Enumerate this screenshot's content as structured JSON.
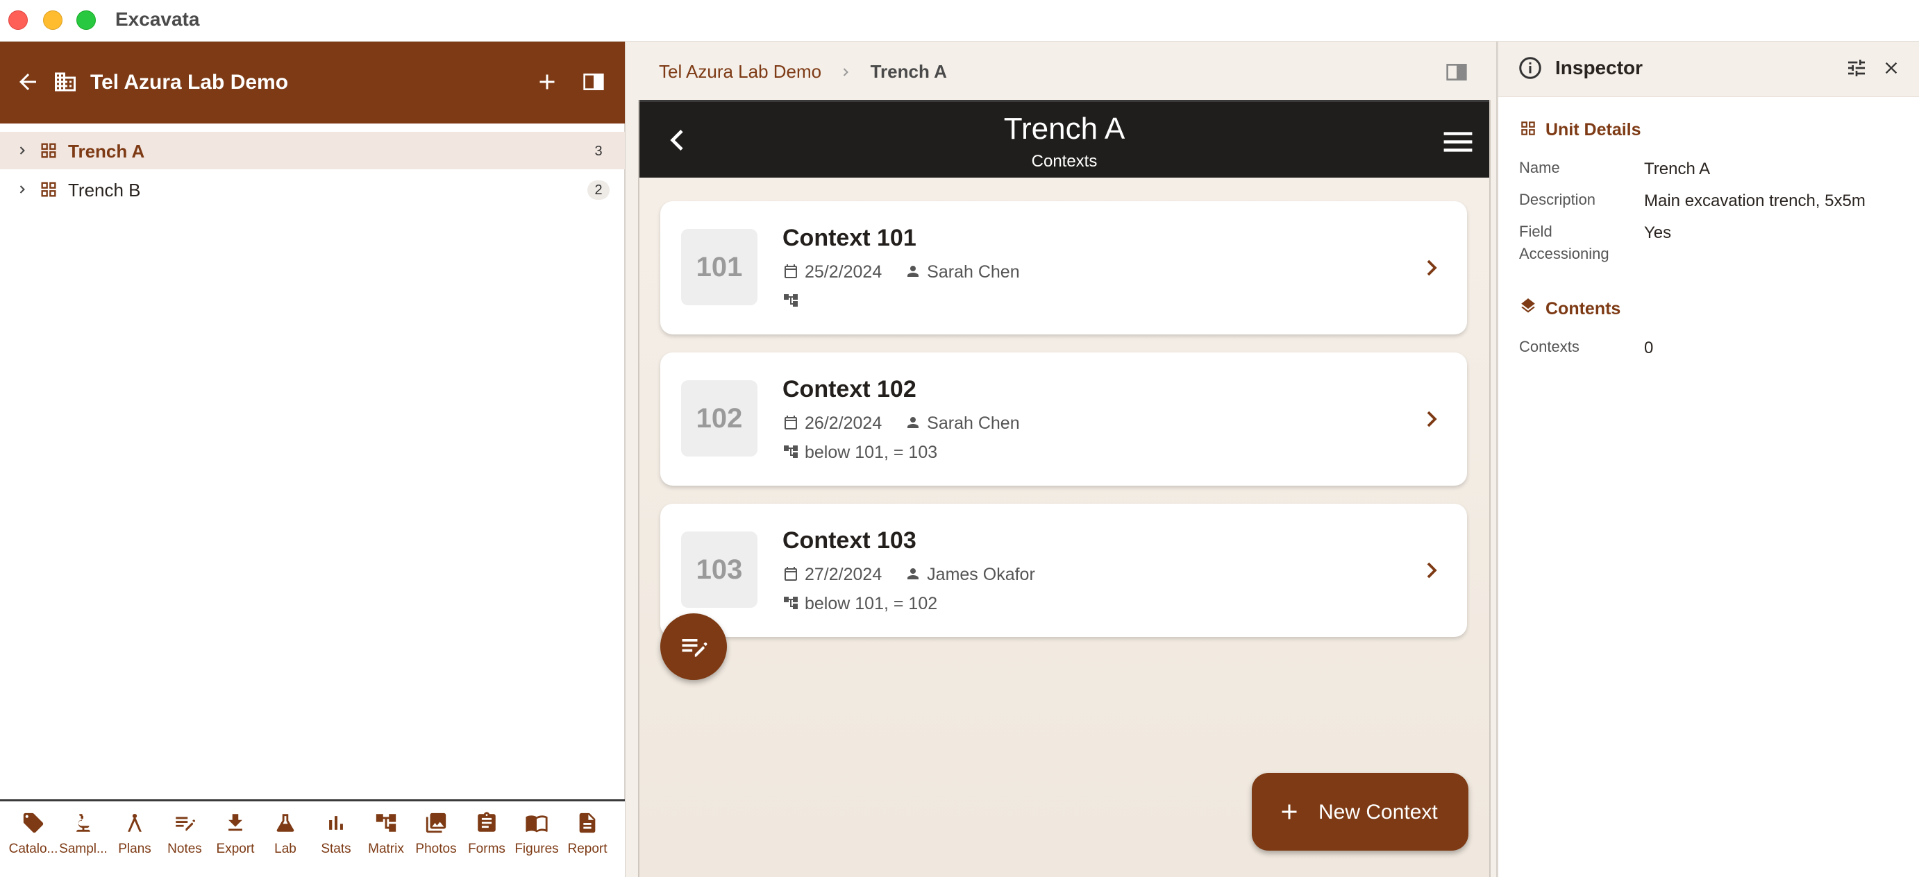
{
  "window": {
    "title": "Excavata"
  },
  "sidebar": {
    "project_title": "Tel Azura Lab Demo",
    "tree": [
      {
        "label": "Trench A",
        "count": "3",
        "selected": true
      },
      {
        "label": "Trench B",
        "count": "2",
        "selected": false
      }
    ],
    "toolbar": [
      {
        "label": "Catalo...",
        "icon": "tag-icon"
      },
      {
        "label": "Sampl...",
        "icon": "microscope-icon"
      },
      {
        "label": "Plans",
        "icon": "compass-icon"
      },
      {
        "label": "Notes",
        "icon": "notes-edit-icon"
      },
      {
        "label": "Export",
        "icon": "download-icon"
      },
      {
        "label": "Lab",
        "icon": "flask-icon"
      },
      {
        "label": "Stats",
        "icon": "bar-chart-icon"
      },
      {
        "label": "Matrix",
        "icon": "hierarchy-icon"
      },
      {
        "label": "Photos",
        "icon": "photos-icon"
      },
      {
        "label": "Forms",
        "icon": "clipboard-icon"
      },
      {
        "label": "Figures",
        "icon": "book-icon"
      },
      {
        "label": "Report",
        "icon": "document-icon"
      }
    ]
  },
  "breadcrumb": {
    "project": "Tel Azura Lab Demo",
    "current": "Trench A"
  },
  "screen": {
    "title": "Trench A",
    "subtitle": "Contexts",
    "cards": [
      {
        "number": "101",
        "title": "Context 101",
        "date": "25/2/2024",
        "author": "Sarah Chen",
        "relations": ""
      },
      {
        "number": "102",
        "title": "Context 102",
        "date": "26/2/2024",
        "author": "Sarah Chen",
        "relations": "below 101, = 103"
      },
      {
        "number": "103",
        "title": "Context 103",
        "date": "27/2/2024",
        "author": "James Okafor",
        "relations": "below 101, = 102"
      }
    ],
    "new_button_label": "New Context"
  },
  "inspector": {
    "title": "Inspector",
    "unit_details_title": "Unit Details",
    "props": [
      {
        "key": "Name",
        "value": "Trench A"
      },
      {
        "key": "Description",
        "value": "Main excavation trench, 5x5m"
      },
      {
        "key": "Field Accessioning",
        "value": "Yes"
      }
    ],
    "contents_title": "Contents",
    "contents": [
      {
        "key": "Contexts",
        "value": "0"
      }
    ]
  },
  "colors": {
    "accent": "#7d3a14",
    "appbar": "#1f1e1c",
    "pane_bg": "#f4efe9"
  }
}
